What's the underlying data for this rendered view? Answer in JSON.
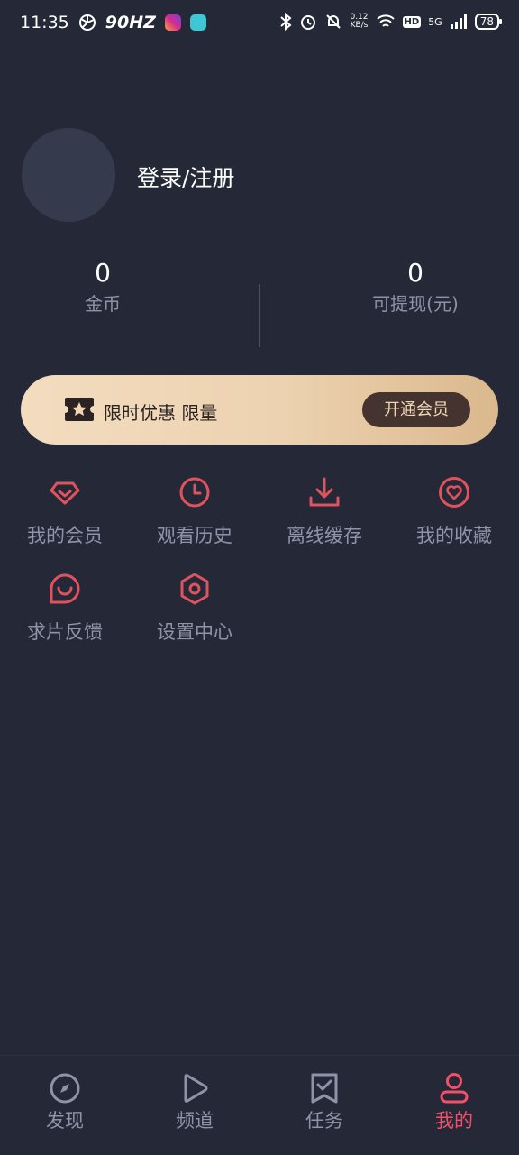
{
  "status_bar": {
    "time": "11:35",
    "refresh_rate": "90HZ",
    "net_speed_value": "0.12",
    "net_speed_unit": "KB/s",
    "hd": "HD",
    "network": "5G",
    "battery": "78"
  },
  "profile": {
    "login_label": "登录/注册"
  },
  "stats": {
    "coins_value": "0",
    "coins_label": "金币",
    "cash_value": "0",
    "cash_label": "可提现(元)"
  },
  "vip_banner": {
    "text": "限时优惠 限量",
    "button_label": "开通会员"
  },
  "menu": [
    {
      "label": "我的会员",
      "icon": "diamond-icon"
    },
    {
      "label": "观看历史",
      "icon": "clock-icon"
    },
    {
      "label": "离线缓存",
      "icon": "download-icon"
    },
    {
      "label": "我的收藏",
      "icon": "heart-icon"
    },
    {
      "label": "求片反馈",
      "icon": "chat-smile-icon"
    },
    {
      "label": "设置中心",
      "icon": "hexagon-settings-icon"
    }
  ],
  "tabs": [
    {
      "label": "发现",
      "icon": "compass-icon"
    },
    {
      "label": "频道",
      "icon": "play-icon"
    },
    {
      "label": "任务",
      "icon": "task-check-icon"
    },
    {
      "label": "我的",
      "icon": "user-icon",
      "active": true
    }
  ],
  "colors": {
    "background": "#252836",
    "accent": "#e0525e",
    "tab_active": "#f2506a",
    "muted_text": "#8f93a8"
  }
}
